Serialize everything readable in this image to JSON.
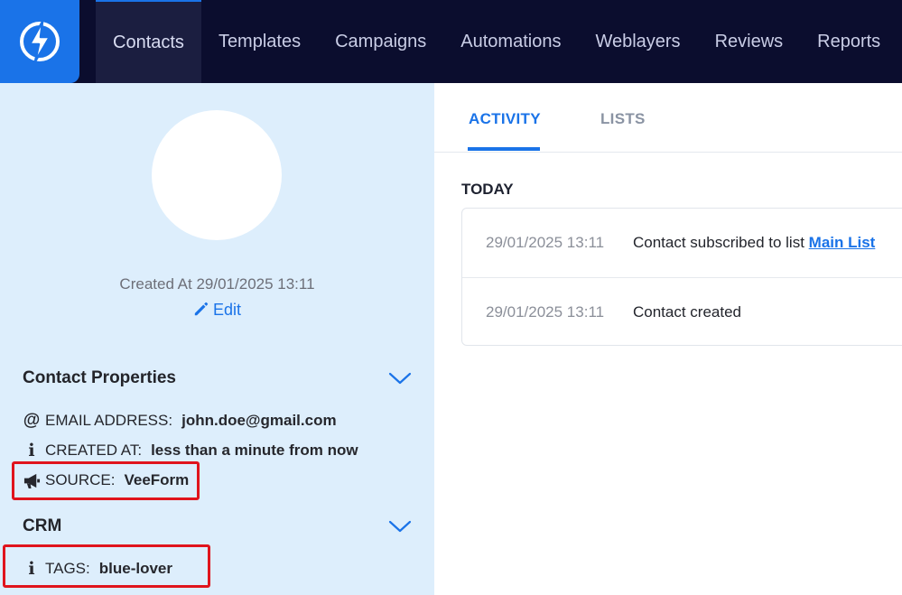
{
  "nav": {
    "items": [
      {
        "label": "Contacts",
        "active": true
      },
      {
        "label": "Templates"
      },
      {
        "label": "Campaigns"
      },
      {
        "label": "Automations"
      },
      {
        "label": "Weblayers"
      },
      {
        "label": "Reviews"
      },
      {
        "label": "Reports"
      }
    ]
  },
  "contact": {
    "created_text": "Created At 29/01/2025 13:11",
    "edit_label": "Edit"
  },
  "properties": {
    "title": "Contact Properties",
    "items": [
      {
        "icon": "at-icon",
        "label": "EMAIL ADDRESS:",
        "value": "john.doe@gmail.com"
      },
      {
        "icon": "info-icon",
        "label": "CREATED AT:",
        "value": "less than a minute from now"
      },
      {
        "icon": "megaphone-icon",
        "label": "SOURCE:",
        "value": "VeeForm"
      }
    ]
  },
  "crm": {
    "title": "CRM",
    "items": [
      {
        "icon": "info-icon",
        "label": "TAGS:",
        "value": "blue-lover"
      }
    ]
  },
  "tabs": {
    "activity": "ACTIVITY",
    "lists": "LISTS"
  },
  "activity": {
    "group_label": "TODAY",
    "rows": [
      {
        "time": "29/01/2025 13:11",
        "text": "Contact subscribed to list ",
        "link": "Main List"
      },
      {
        "time": "29/01/2025 13:11",
        "text": "Contact created",
        "link": ""
      }
    ]
  },
  "colors": {
    "accent": "#1a73e8",
    "nav_bg": "#0b0d2e",
    "panel_bg": "#ddeefc",
    "highlight": "#e0141c"
  }
}
